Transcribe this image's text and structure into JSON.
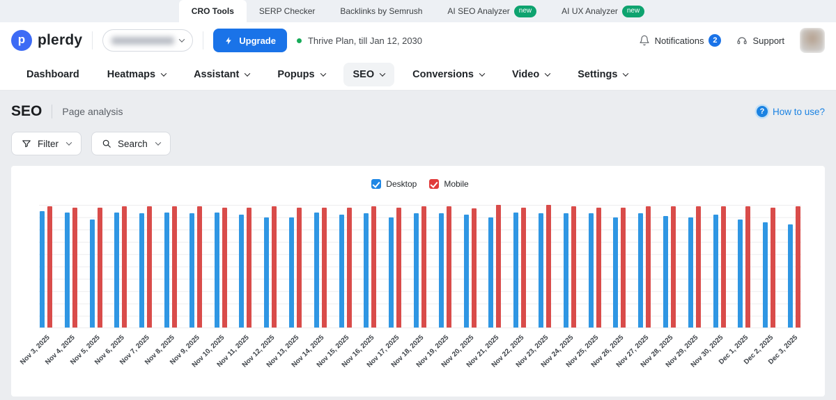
{
  "colors": {
    "accent_blue": "#1a73e8",
    "desktop_bar": "#2f96e3",
    "mobile_bar": "#d94c4a",
    "desktop_checkbox": "#1e87e5",
    "mobile_checkbox": "#e13b3b",
    "new_badge_green": "#0ea36f",
    "plan_dot_green": "#17ab59",
    "link_blue": "#1a82e2"
  },
  "top_tabs": {
    "items": [
      {
        "label": "CRO Tools",
        "active": true,
        "badge": null
      },
      {
        "label": "SERP Checker",
        "active": false,
        "badge": null
      },
      {
        "label": "Backlinks by Semrush",
        "active": false,
        "badge": null
      },
      {
        "label": "AI SEO Analyzer",
        "active": false,
        "badge": "new"
      },
      {
        "label": "AI UX Analyzer",
        "active": false,
        "badge": "new"
      }
    ]
  },
  "header": {
    "brand": "plerdy",
    "upgrade_label": "Upgrade",
    "plan_text": "Thrive Plan, till Jan 12, 2030",
    "notifications_label": "Notifications",
    "notifications_count": "2",
    "support_label": "Support"
  },
  "nav": {
    "items": [
      {
        "label": "Dashboard",
        "dropdown": false,
        "active": false
      },
      {
        "label": "Heatmaps",
        "dropdown": true,
        "active": false
      },
      {
        "label": "Assistant",
        "dropdown": true,
        "active": false
      },
      {
        "label": "Popups",
        "dropdown": true,
        "active": false
      },
      {
        "label": "SEO",
        "dropdown": true,
        "active": true
      },
      {
        "label": "Conversions",
        "dropdown": true,
        "active": false
      },
      {
        "label": "Video",
        "dropdown": true,
        "active": false
      },
      {
        "label": "Settings",
        "dropdown": true,
        "active": false
      }
    ]
  },
  "page": {
    "title": "SEO",
    "subtitle": "Page analysis",
    "how_to_use_label": "How to use?",
    "filter_label": "Filter",
    "search_label": "Search"
  },
  "chart_data": {
    "type": "bar",
    "title": "",
    "xlabel": "",
    "ylabel": "",
    "legend_position": "top",
    "grid": true,
    "y_axis_labels_visible": false,
    "ylim": [
      0,
      100
    ],
    "note": "No y-axis tick labels shown; values are relative heights in % of chart maximum.",
    "categories": [
      "Nov 3, 2025",
      "Nov 4, 2025",
      "Nov 5, 2025",
      "Nov 6, 2025",
      "Nov 7, 2025",
      "Nov 8, 2025",
      "Nov 9, 2025",
      "Nov 10, 2025",
      "Nov 11, 2025",
      "Nov 12, 2025",
      "Nov 13, 2025",
      "Nov 14, 2025",
      "Nov 15, 2025",
      "Nov 16, 2025",
      "Nov 17, 2025",
      "Nov 18, 2025",
      "Nov 19, 2025",
      "Nov 20, 2025",
      "Nov 21, 2025",
      "Nov 22, 2025",
      "Nov 23, 2025",
      "Nov 24, 2025",
      "Nov 25, 2025",
      "Nov 26, 2025",
      "Nov 27, 2025",
      "Nov 28, 2025",
      "Nov 29, 2025",
      "Nov 30, 2025",
      "Dec 1, 2025",
      "Dec 2, 2025",
      "Dec 3, 2025"
    ],
    "series": [
      {
        "name": "Desktop",
        "color": "#2f96e3",
        "checkbox_color": "#1e87e5",
        "values": [
          95,
          94,
          88,
          94,
          93,
          94,
          93,
          94,
          92,
          90,
          90,
          94,
          92,
          93,
          90,
          93,
          93,
          92,
          90,
          94,
          93,
          93,
          93,
          90,
          93,
          91,
          90,
          92,
          88,
          86,
          84
        ]
      },
      {
        "name": "Mobile",
        "color": "#d94c4a",
        "checkbox_color": "#e13b3b",
        "values": [
          99,
          98,
          98,
          99,
          99,
          99,
          99,
          98,
          98,
          99,
          98,
          98,
          98,
          99,
          98,
          99,
          99,
          97,
          100,
          98,
          100,
          99,
          98,
          98,
          99,
          99,
          99,
          99,
          99,
          98,
          99
        ]
      }
    ]
  }
}
